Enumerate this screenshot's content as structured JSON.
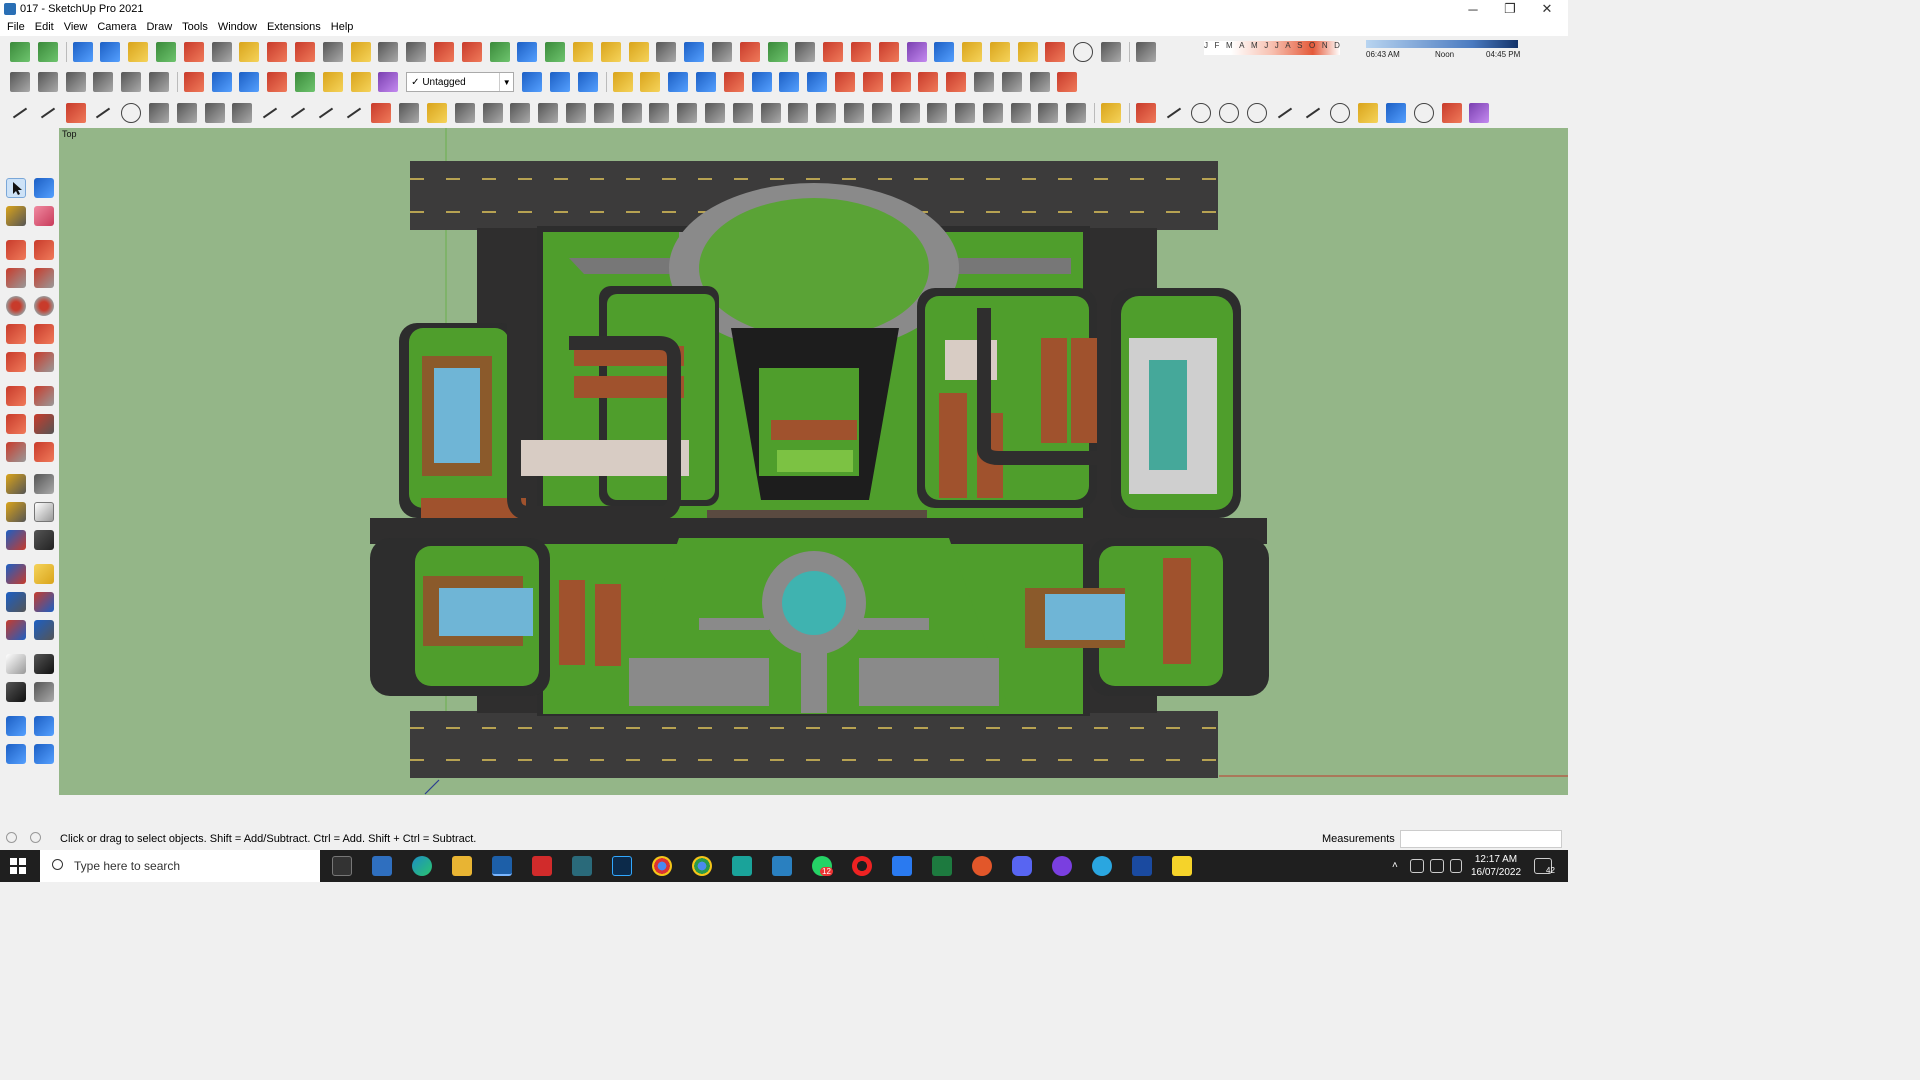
{
  "window": {
    "title": "017 - SketchUp Pro 2021",
    "controls": [
      "minimize-icon",
      "restore-icon",
      "close-icon"
    ]
  },
  "menu": [
    "File",
    "Edit",
    "View",
    "Camera",
    "Draw",
    "Tools",
    "Window",
    "Extensions",
    "Help"
  ],
  "tag_selector": {
    "value": "Untagged",
    "check": "✓"
  },
  "shadow": {
    "months": [
      "J",
      "F",
      "M",
      "A",
      "M",
      "J",
      "J",
      "A",
      "S",
      "O",
      "N",
      "D"
    ],
    "time_start": "06:43 AM",
    "time_mid": "Noon",
    "time_end": "04:45 PM"
  },
  "viewport": {
    "view_label": "Top"
  },
  "status": {
    "message": "Click or drag to select objects. Shift = Add/Subtract. Ctrl = Add. Shift + Ctrl = Subtract.",
    "measurements_label": "Measurements",
    "measurements_value": ""
  },
  "taskbar": {
    "search_placeholder": "Type here to search",
    "time": "12:17 AM",
    "date": "16/07/2022",
    "notifications": "42",
    "whatsapp_badge": "12"
  },
  "colors": {
    "viewport_bg": "#94b688",
    "road": "#3c3b3b",
    "lawn": "#4f9e2c",
    "water": "#6fb5d6",
    "wood": "#a0522d",
    "taskbar": "#1f1f1f"
  }
}
